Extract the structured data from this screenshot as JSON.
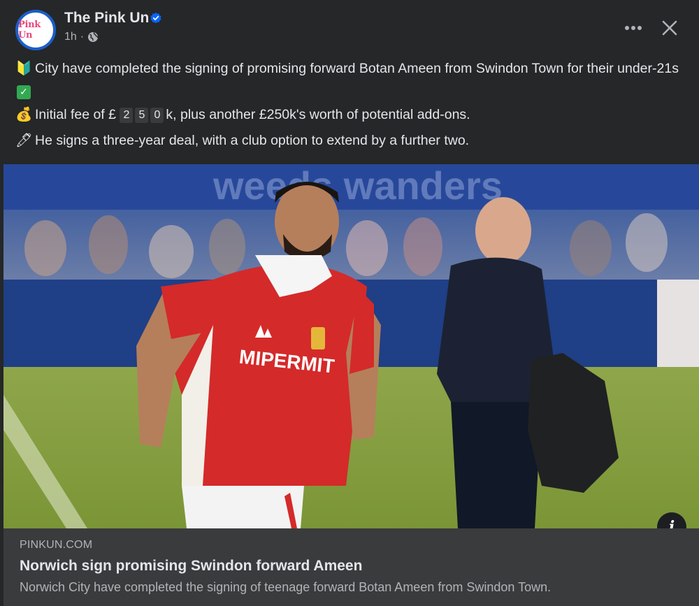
{
  "header": {
    "avatar_text": "Pink Un",
    "page_name": "The Pink Un",
    "time": "1h",
    "separator": "·",
    "icons": {
      "verified": "verified-badge-icon",
      "audience": "globe-icon",
      "more": "more-options-icon",
      "close": "close-icon"
    }
  },
  "post": {
    "line1_emoji": "🔰",
    "line1_text": "City have completed the signing of promising forward Botan Ameen from Swindon Town for their under-21s",
    "line1_check": "✓",
    "line2_emoji": "💰",
    "line2_prefix": "Initial fee of £",
    "line2_digits": [
      "2",
      "5",
      "0"
    ],
    "line2_suffix": "k, plus another £250k's worth of potential add-ons.",
    "line3_emoji": "🖊",
    "line3_text": "He signs a three-year deal, with a club option to extend by a further two."
  },
  "photo": {
    "shirt_sponsor": "MIPERMIT",
    "info_button": "i"
  },
  "link_preview": {
    "domain": "PINKUN.COM",
    "title": "Norwich sign promising Swindon forward Ameen",
    "description": "Norwich City have completed the signing of teenage forward Botan Ameen from Swindon Town."
  },
  "colors": {
    "background": "#252728",
    "card": "#3a3b3c",
    "text_primary": "#e4e6eb",
    "text_secondary": "#b0b3b8",
    "verified_blue": "#0866ff"
  }
}
